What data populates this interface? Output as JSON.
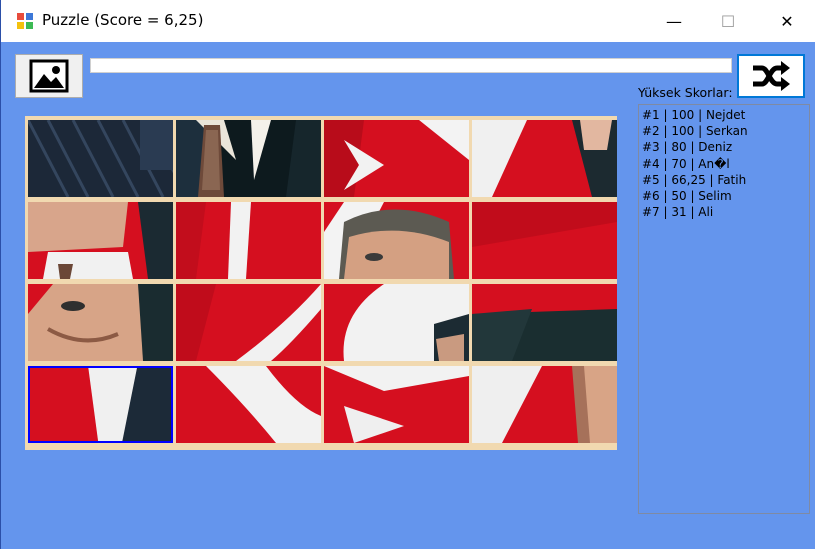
{
  "window": {
    "title": "Puzzle (Score = 6,25)",
    "controls": {
      "minimize": "—",
      "maximize": "☐",
      "close": "✕"
    }
  },
  "toolbar": {
    "image_button_icon": "image-icon",
    "shuffle_button_icon": "shuffle-icon",
    "progress": 0
  },
  "high_scores": {
    "label": "Yüksek Skorlar:",
    "items": [
      "#1 | 100 | Nejdet",
      "#2 | 100 | Serkan",
      "#3 | 80 | Deniz",
      "#4 | 70 | An�l",
      "#5 | 66,25 | Fatih",
      "#6 | 50 | Selim",
      "#7 | 31 | Ali"
    ]
  },
  "board": {
    "rows": 4,
    "cols": 4,
    "selected_tile": "r3c0"
  },
  "colors": {
    "background": "#6495ed",
    "board_frame": "#f1d9b0",
    "flag_red": "#d50f1f",
    "selection": "#0000ff"
  }
}
